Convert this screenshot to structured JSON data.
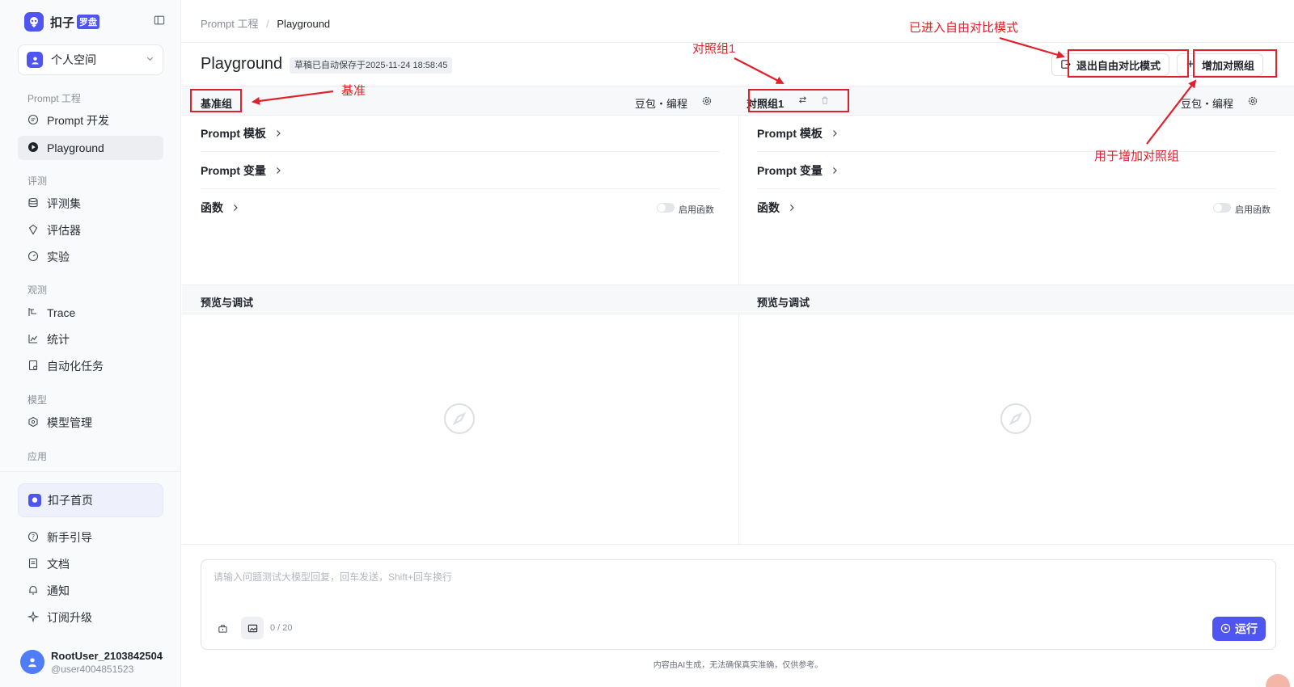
{
  "brand": {
    "name": "扣子",
    "badge": "罗盘"
  },
  "space": {
    "label": "个人空间"
  },
  "sidebar": {
    "sections": [
      {
        "title": "Prompt 工程",
        "items": [
          {
            "label": "Prompt 开发",
            "icon": "chat-bubble-icon"
          },
          {
            "label": "Playground",
            "icon": "play-circle-icon",
            "active": true
          }
        ]
      },
      {
        "title": "评测",
        "items": [
          {
            "label": "评测集",
            "icon": "database-icon"
          },
          {
            "label": "评估器",
            "icon": "badge-icon"
          },
          {
            "label": "实验",
            "icon": "gauge-icon"
          }
        ]
      },
      {
        "title": "观测",
        "items": [
          {
            "label": "Trace",
            "icon": "trace-icon"
          },
          {
            "label": "统计",
            "icon": "chart-icon"
          },
          {
            "label": "自动化任务",
            "icon": "task-icon"
          }
        ]
      },
      {
        "title": "模型",
        "items": [
          {
            "label": "模型管理",
            "icon": "cube-icon"
          }
        ]
      },
      {
        "title": "应用",
        "items": []
      }
    ],
    "home": "扣子首页",
    "footer_items": [
      {
        "label": "新手引导",
        "icon": "help-icon"
      },
      {
        "label": "文档",
        "icon": "doc-icon"
      },
      {
        "label": "通知",
        "icon": "bell-icon"
      },
      {
        "label": "订阅升级",
        "icon": "sparkle-icon"
      }
    ],
    "user": {
      "name": "RootUser_2103842504",
      "handle": "@user4004851523"
    }
  },
  "breadcrumb": {
    "parent": "Prompt 工程",
    "sep": "/",
    "current": "Playground"
  },
  "page": {
    "title": "Playground",
    "draft": "草稿已自动保存于2025-11-24 18:58:45",
    "exit_compare_label": "退出自由对比模式",
    "add_group_label": "增加对照组"
  },
  "panels": [
    {
      "title": "基准组",
      "model": "豆包・编程"
    },
    {
      "title": "对照组1",
      "model": "豆包・编程"
    }
  ],
  "rows": {
    "template": "Prompt 模板",
    "variables": "Prompt 变量",
    "functions": "函数",
    "enable_functions": "启用函数"
  },
  "preview": {
    "title": "预览与调试"
  },
  "chat": {
    "placeholder": "请输入问题测试大模型回复，回车发送，Shift+回车换行",
    "counter": "0 / 20",
    "run_label": "运行",
    "disclaimer": "内容由AI生成，无法确保真实准确，仅供参考。"
  },
  "annotations": {
    "baseline": "基准",
    "control1": "对照组1",
    "compare_mode": "已进入自由对比模式",
    "add_group": "用于增加对照组"
  },
  "colors": {
    "accent": "#4f55f1",
    "annotation": "#e0202a"
  }
}
